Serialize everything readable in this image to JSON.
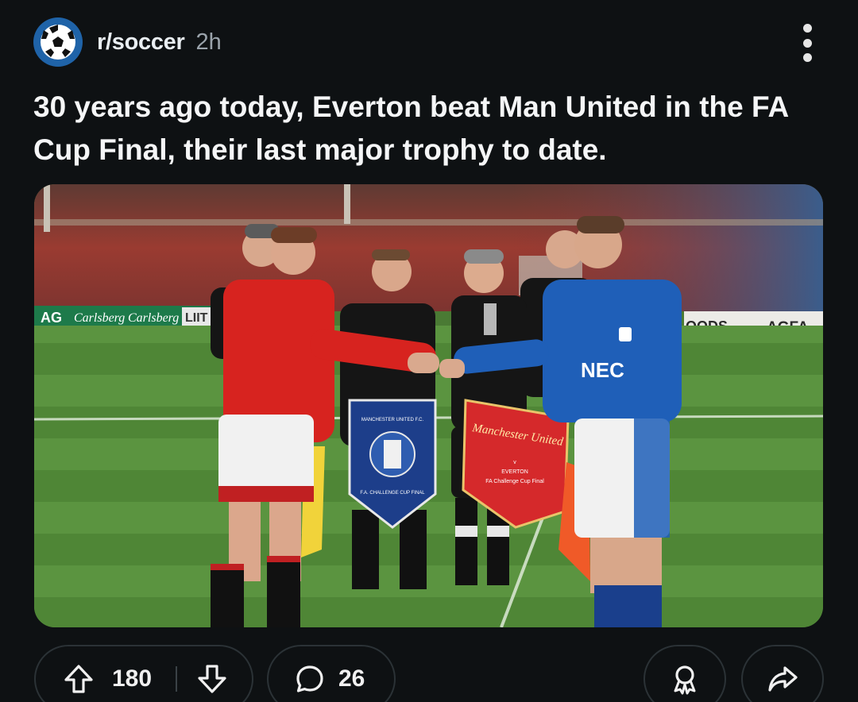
{
  "post": {
    "subreddit": "r/soccer",
    "age": "2h",
    "title": "30 years ago today, Everton beat Man United in the FA Cup Final, their last major trophy to date.",
    "image": {
      "board_left_1": "AG",
      "board_left_2": "Carlsberg",
      "board_left_3": "Carlsberg",
      "board_left_4": "LIIT",
      "board_right_1": "OODS",
      "board_right_2": "AGFA",
      "shirt_sponsor": "NEC",
      "pennant_red_text": "Manchester United",
      "pennant_red_small_1": "v",
      "pennant_red_small_2": "EVERTON",
      "pennant_red_small_3": "FA Challenge Cup Final",
      "pennant_blue_small_1": "MANCHESTER UNITED F.C.",
      "pennant_blue_small_2": "F.A. CHALLENGE CUP FINAL"
    }
  },
  "actions": {
    "upvotes": "180",
    "comments": "26"
  },
  "colors": {
    "background": "#0e1113",
    "avatar": "#1f63a8",
    "pill_border": "#2b3236"
  }
}
